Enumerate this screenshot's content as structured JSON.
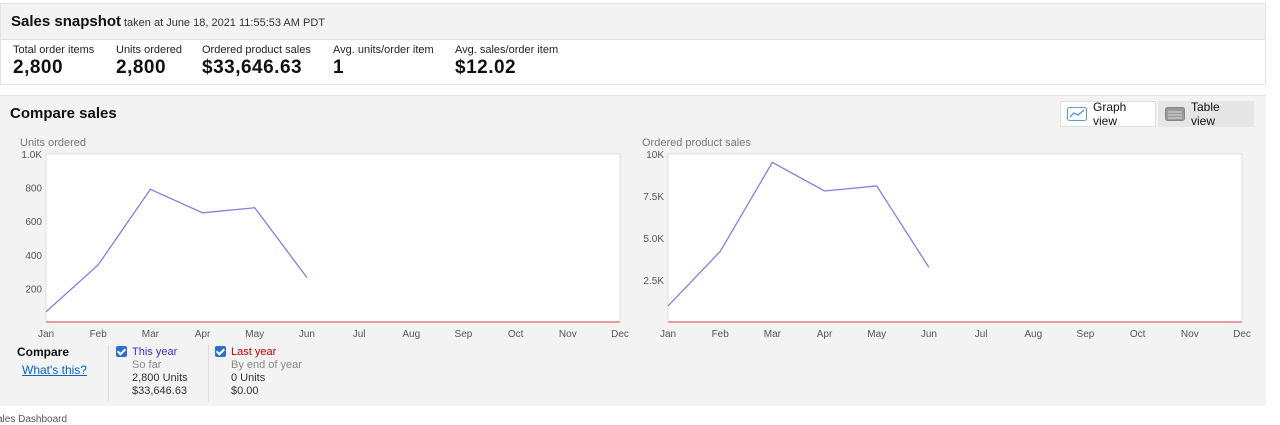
{
  "snapshot": {
    "title": "Sales snapshot",
    "taken": "taken at June 18, 2021 11:55:53 AM PDT"
  },
  "metrics": [
    {
      "label": "Total order items",
      "value": "2,800"
    },
    {
      "label": "Units ordered",
      "value": "2,800"
    },
    {
      "label": "Ordered product sales",
      "value": "$33,646.63"
    },
    {
      "label": "Avg. units/order item",
      "value": "1"
    },
    {
      "label": "Avg. sales/order item",
      "value": "$12.02"
    }
  ],
  "compare": {
    "title": "Compare sales",
    "graph_view_label": "Graph view",
    "table_view_label": "Table view",
    "graph_view_icon": "line-chart-icon",
    "table_view_icon": "table-icon",
    "legend": {
      "title": "Compare",
      "link": "What's this?",
      "this_year": {
        "name": "This year",
        "sub": "So far",
        "units": "2,800 Units",
        "sales": "$33,646.63",
        "color": "#3333cc"
      },
      "last_year": {
        "name": "Last year",
        "sub": "By end of year",
        "units": "0 Units",
        "sales": "$0.00",
        "color": "#c00000"
      }
    }
  },
  "chart_data": [
    {
      "type": "line",
      "title": "Units ordered",
      "categories": [
        "Jan",
        "Feb",
        "Mar",
        "Apr",
        "May",
        "Jun",
        "Jul",
        "Aug",
        "Sep",
        "Oct",
        "Nov",
        "Dec"
      ],
      "ylim": [
        0,
        1000
      ],
      "yticks": [
        200,
        400,
        600,
        800,
        1000
      ],
      "ytick_labels": [
        "200",
        "400",
        "600",
        "800",
        "1.0K"
      ],
      "series": [
        {
          "color": "#8080e0",
          "values": [
            60,
            340,
            790,
            650,
            680,
            265
          ]
        },
        {
          "color": "#e08080",
          "values": [
            0,
            0,
            0,
            0,
            0,
            0,
            0,
            0,
            0,
            0,
            0,
            0
          ]
        }
      ]
    },
    {
      "type": "line",
      "title": "Ordered product sales",
      "categories": [
        "Jan",
        "Feb",
        "Mar",
        "Apr",
        "May",
        "Jun",
        "Jul",
        "Aug",
        "Sep",
        "Oct",
        "Nov",
        "Dec"
      ],
      "ylim": [
        0,
        10000
      ],
      "yticks": [
        2500,
        5000,
        7500,
        10000
      ],
      "ytick_labels": [
        "2.5K",
        "5.0K",
        "7.5K",
        "10K"
      ],
      "series": [
        {
          "color": "#8080e0",
          "values": [
            950,
            4200,
            9500,
            7800,
            8100,
            3250
          ]
        },
        {
          "color": "#e08080",
          "values": [
            0,
            0,
            0,
            0,
            0,
            0,
            0,
            0,
            0,
            0,
            0,
            0
          ]
        }
      ]
    }
  ],
  "footer": {
    "text": "ales Dashboard"
  }
}
